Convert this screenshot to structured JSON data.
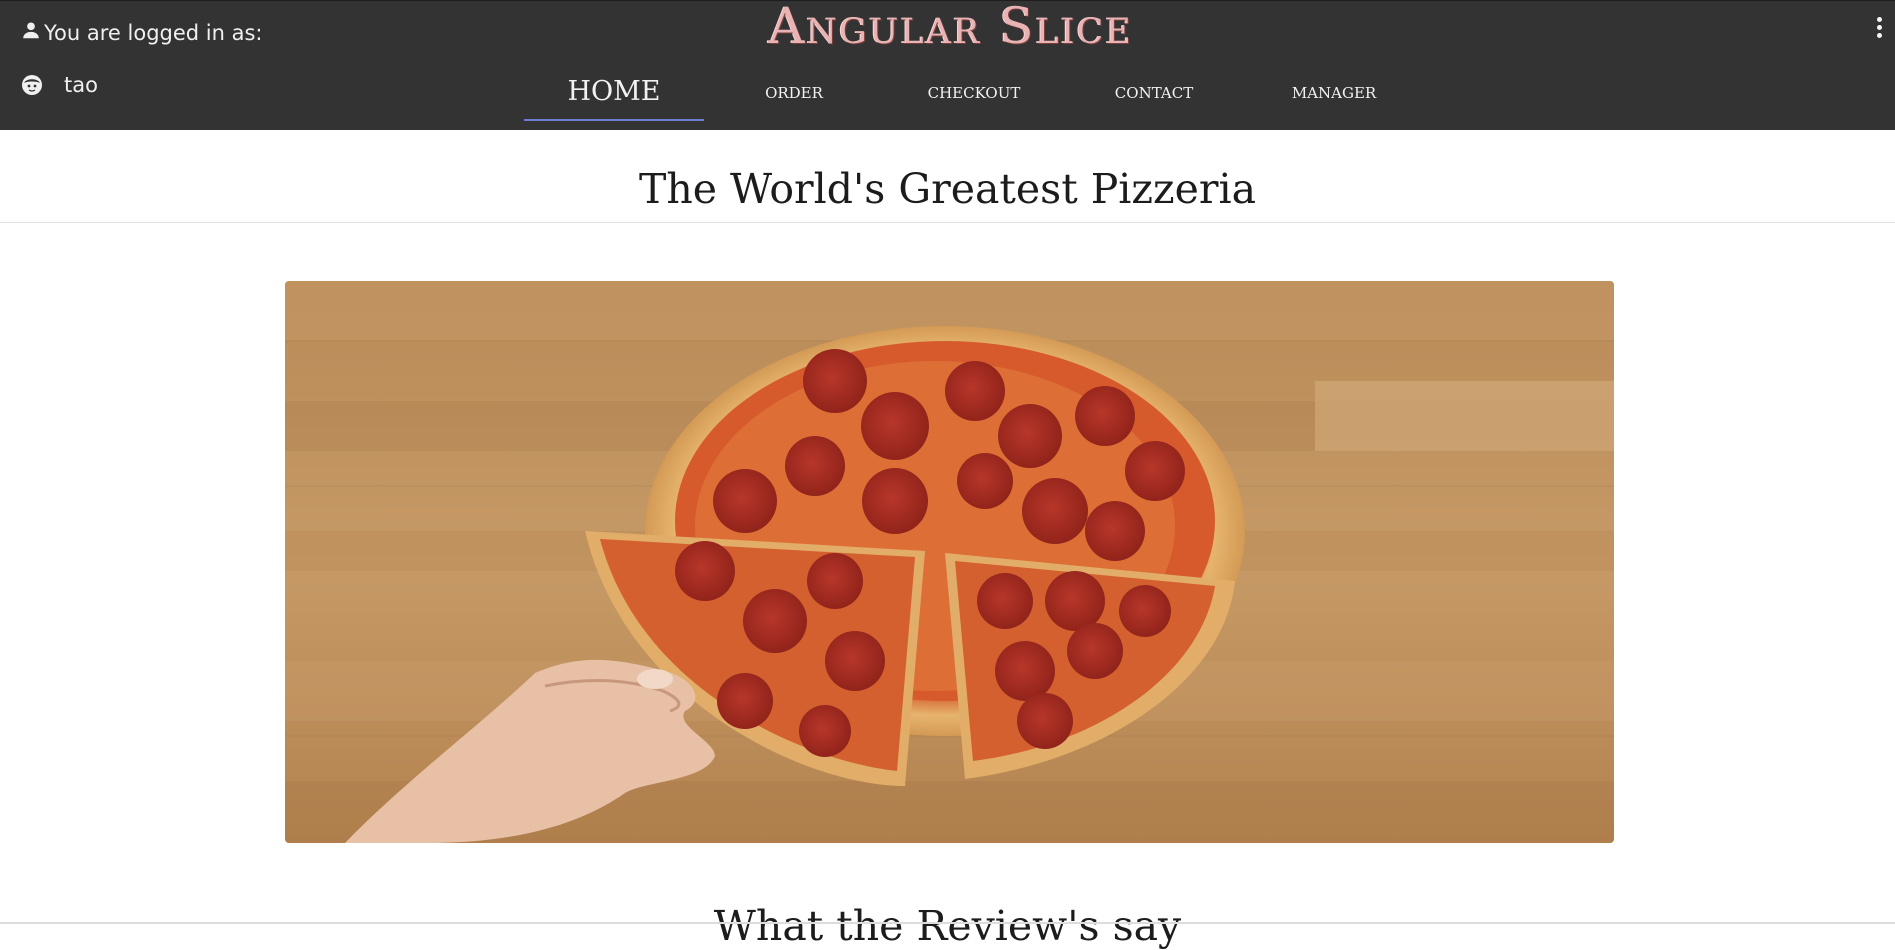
{
  "header": {
    "logged_in_label": "You are logged in as:",
    "username": "tao",
    "brand": "Angular Slice",
    "user_icon": "person-icon",
    "avatar_icon": "face-icon",
    "menu_icon": "kebab-menu-icon"
  },
  "nav": {
    "items": [
      {
        "label": "HOME",
        "active": true
      },
      {
        "label": "ORDER",
        "active": false
      },
      {
        "label": "CHECKOUT",
        "active": false
      },
      {
        "label": "CONTACT",
        "active": false
      },
      {
        "label": "MANAGER",
        "active": false
      }
    ]
  },
  "main": {
    "title": "The World's Greatest Pizzeria",
    "reviews_title": "What the Review's say"
  },
  "colors": {
    "topbar": "#333333",
    "nav_underline": "#6b7bd6",
    "brand": "#e9b3b3"
  }
}
